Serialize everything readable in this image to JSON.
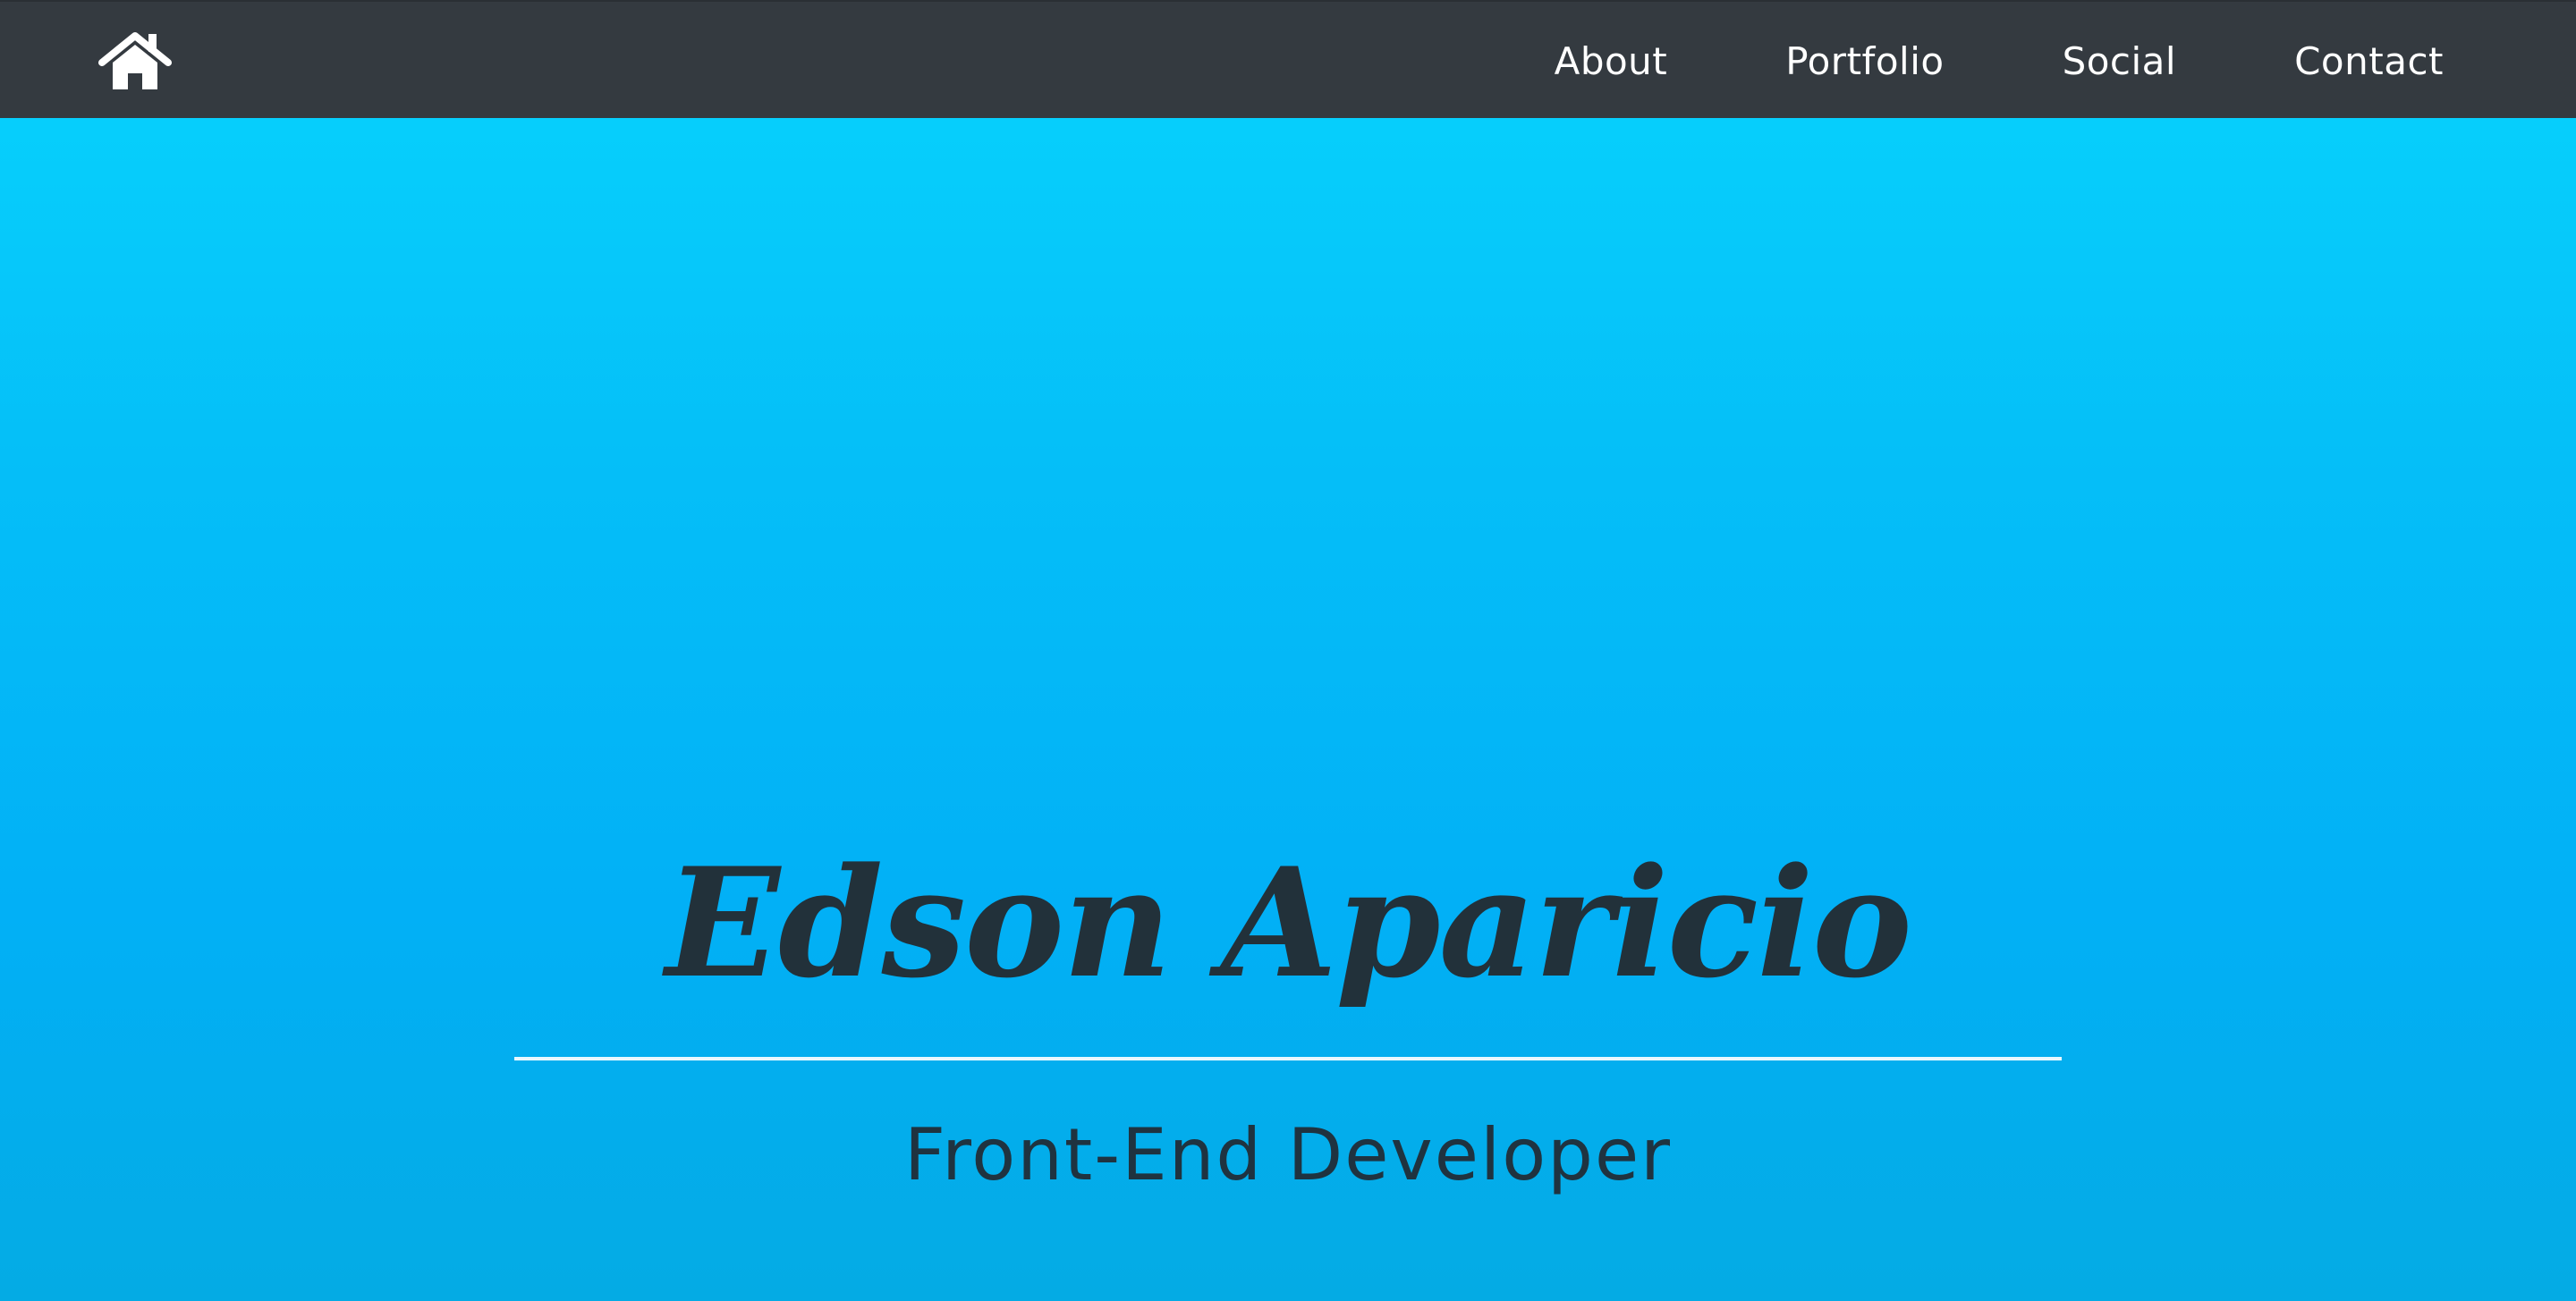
{
  "navbar": {
    "home_icon": "home-icon",
    "links": [
      {
        "label": "About"
      },
      {
        "label": "Portfolio"
      },
      {
        "label": "Social"
      },
      {
        "label": "Contact"
      }
    ],
    "background_color": "#343a40",
    "text_color": "#ffffff"
  },
  "hero": {
    "name": "Edson Aparicio",
    "subtitle": "Front-End Developer",
    "gradient_top": "#07d4fd",
    "gradient_bottom": "#04abe4",
    "name_color": "#22313a"
  }
}
